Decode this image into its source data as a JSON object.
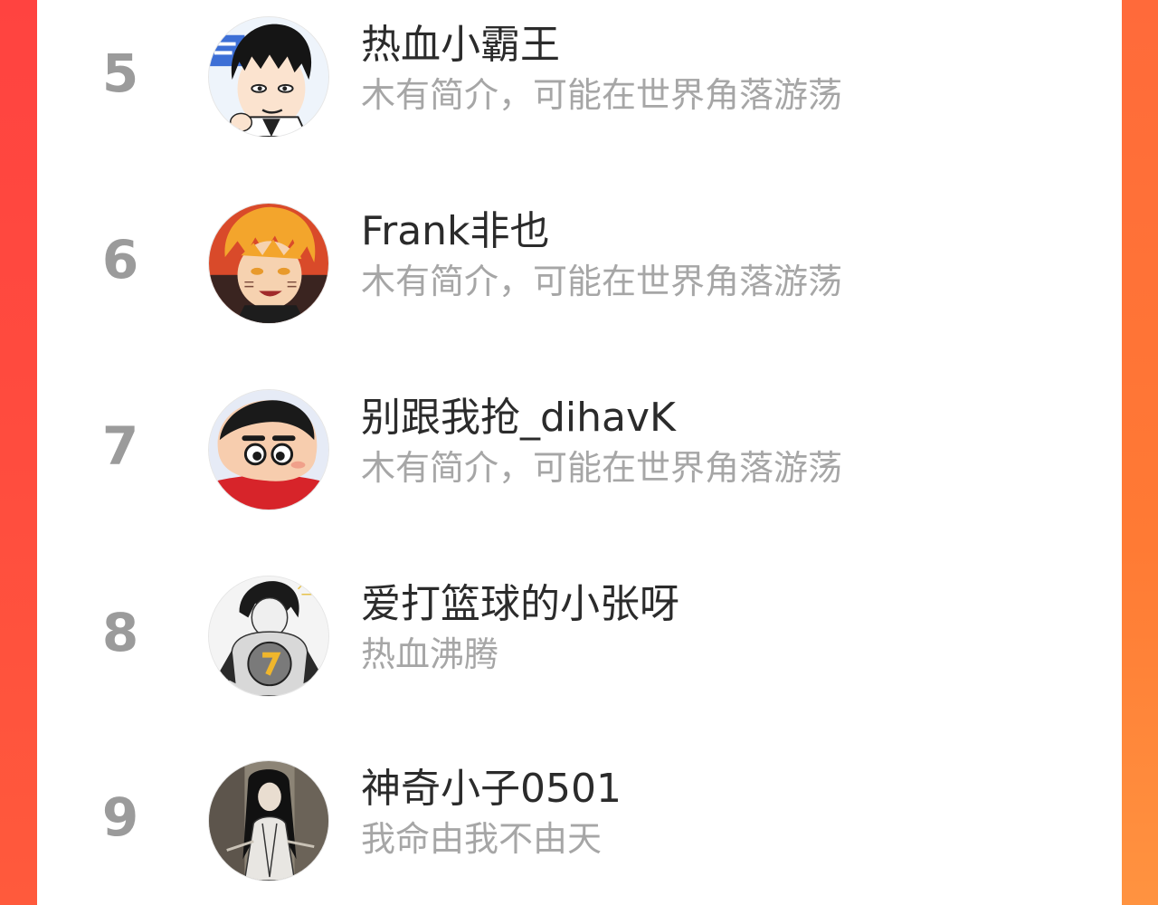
{
  "ranking": {
    "rows": [
      {
        "rank": "5",
        "name": "热血小霸王",
        "bio": "木有简介，可能在世界角落游荡",
        "avatar_icon": "anime-boy-black-hair-avatar"
      },
      {
        "rank": "6",
        "name": "Frank非也",
        "bio": "木有简介，可能在世界角落游荡",
        "avatar_icon": "anime-boy-orange-hair-avatar"
      },
      {
        "rank": "7",
        "name": "别跟我抢_dihavK",
        "bio": "木有简介，可能在世界角落游荡",
        "avatar_icon": "cartoon-boy-avatar"
      },
      {
        "rank": "8",
        "name": "爱打篮球的小张呀",
        "bio": "热血沸腾",
        "avatar_icon": "basketball-player-sketch-avatar"
      },
      {
        "rank": "9",
        "name": "神奇小子0501",
        "bio": "我命由我不由天",
        "avatar_icon": "dark-haired-warrior-avatar"
      }
    ]
  },
  "colors": {
    "background_gradient_top": "#ff4a40",
    "background_gradient_bottom": "#ff8d3a",
    "rank_text": "#9b9b9b",
    "name_text": "#2b2b2b",
    "bio_text": "#a6a6a6"
  }
}
